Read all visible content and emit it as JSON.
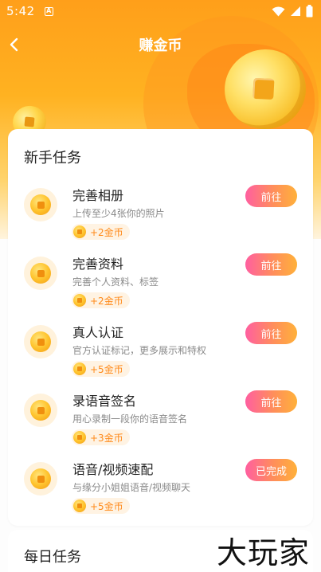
{
  "status_bar": {
    "time": "5:42",
    "notification_letter": "A"
  },
  "nav": {
    "title": "赚金币",
    "back_icon": "chevron-left-icon"
  },
  "sections": [
    {
      "title": "新手任务",
      "tasks": [
        {
          "name": "完善相册",
          "desc": "上传至少4张你的照片",
          "reward": "+2金币",
          "button": "前往"
        },
        {
          "name": "完善资料",
          "desc": "完善个人资料、标签",
          "reward": "+2金币",
          "button": "前往"
        },
        {
          "name": "真人认证",
          "desc": "官方认证标记，更多展示和特权",
          "reward": "+5金币",
          "button": "前往"
        },
        {
          "name": "录语音签名",
          "desc": "用心录制一段你的语音签名",
          "reward": "+3金币",
          "button": "前往"
        },
        {
          "name": "语音/视频速配",
          "desc": "与缘分小姐姐语音/视频聊天",
          "reward": "+5金币",
          "button": "已完成"
        }
      ]
    },
    {
      "title": "每日任务"
    }
  ],
  "watermark": "大玩家",
  "colors": {
    "header_orange": "#ffa51e",
    "button_gradient_start": "#ff5fa0",
    "button_gradient_end": "#ffb13a",
    "reward_text": "#ff8a1a"
  }
}
